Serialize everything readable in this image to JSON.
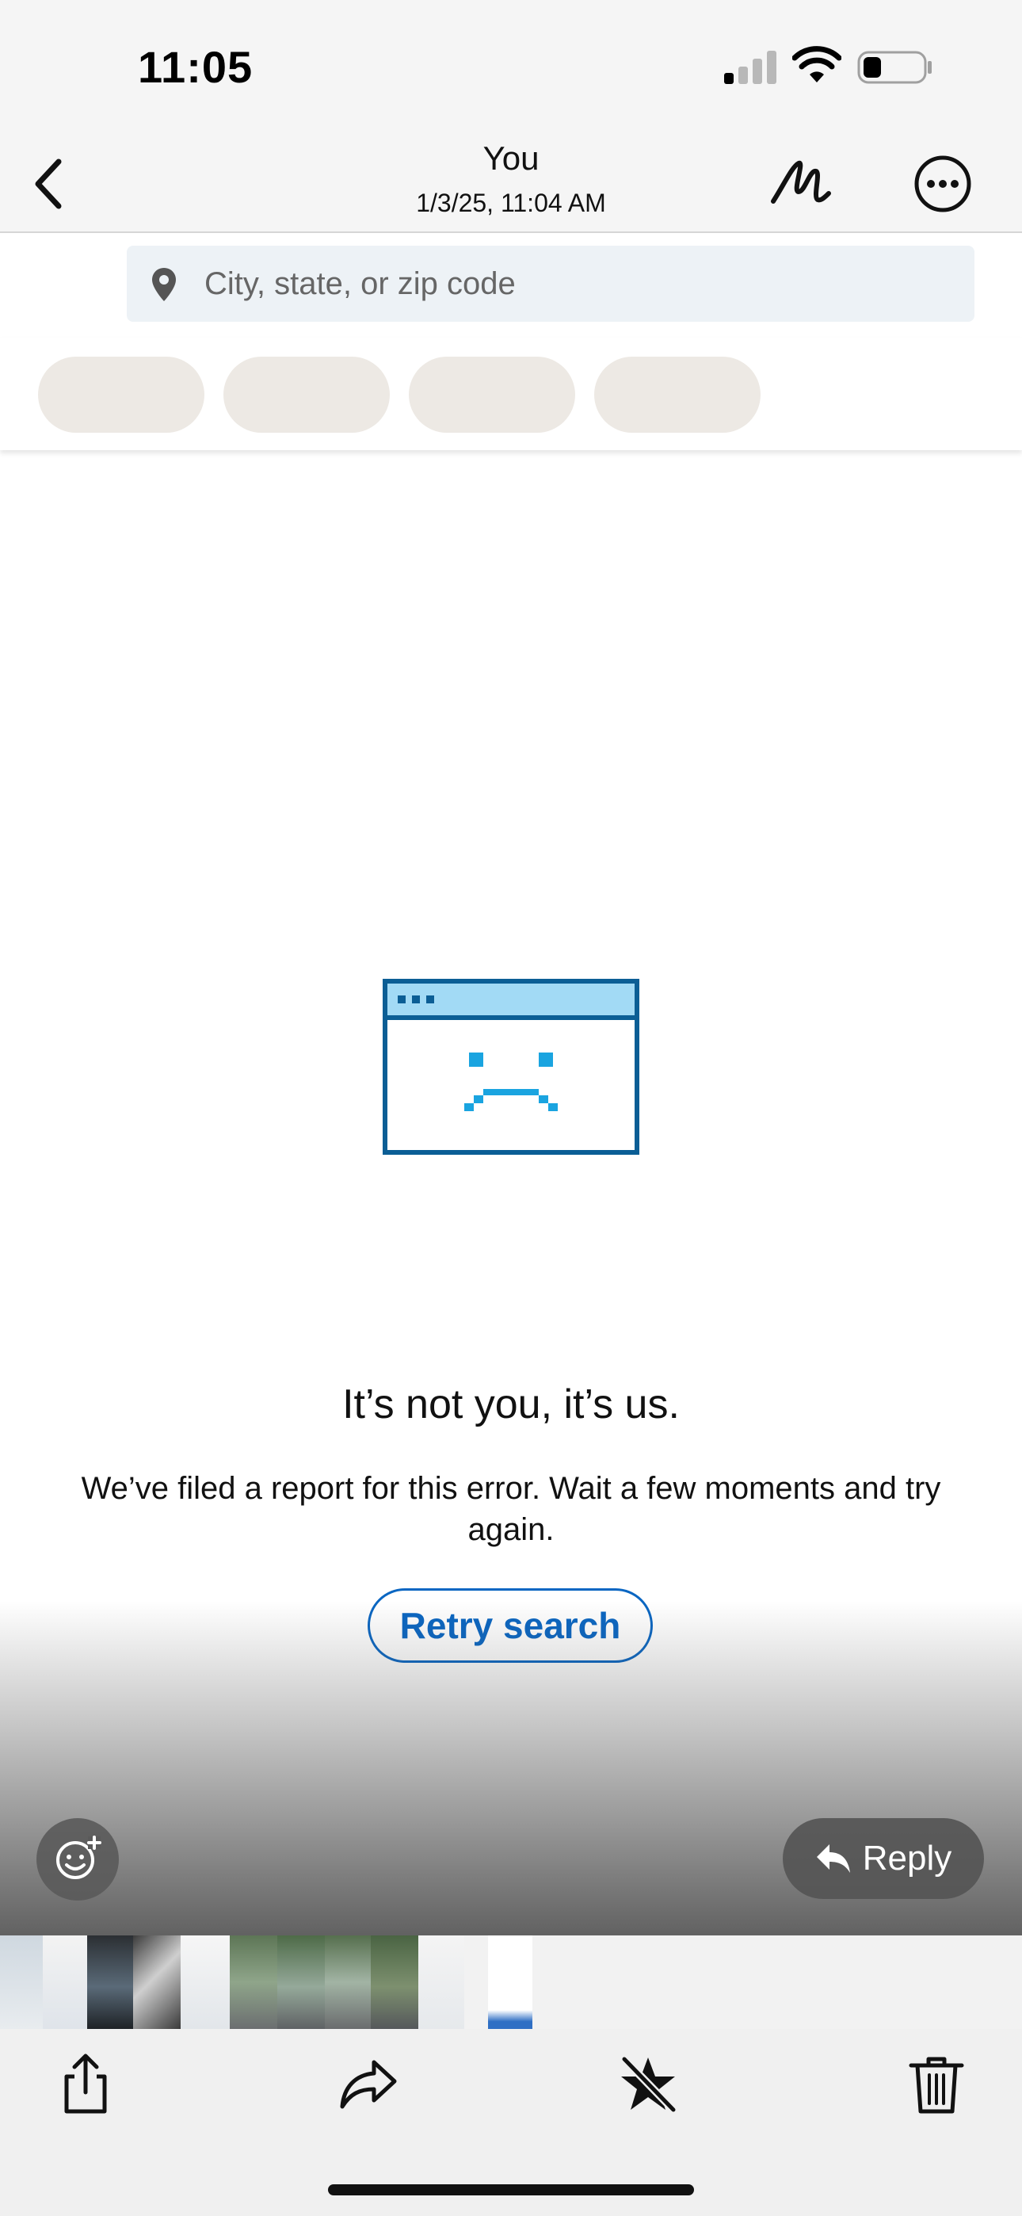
{
  "status_bar": {
    "time": "11:05"
  },
  "header": {
    "title": "You",
    "subtitle": "1/3/25, 11:04 AM"
  },
  "search": {
    "placeholder": "City, state, or zip code"
  },
  "error": {
    "title": "It’s not you, it’s us.",
    "message": "We’ve filed a report for this error. Wait a few moments and try again.",
    "retry_label": "Retry search"
  },
  "viewer_actions": {
    "reply_label": "Reply"
  },
  "icons": {
    "back": "chevron-left-icon",
    "markup": "markup-pen-icon",
    "more": "more-ellipsis-icon",
    "location": "location-pin-icon",
    "error_illustration": "sad-browser-window-icon",
    "emoji": "emoji-add-icon",
    "reply": "reply-arrow-icon",
    "share": "share-icon",
    "forward": "forward-icon",
    "unfavorite": "star-slash-icon",
    "trash": "trash-icon"
  },
  "colors": {
    "accent": "#0a66c2",
    "illustration_dark": "#0b5e95",
    "illustration_light": "#1aa4e0",
    "illustration_bar": "#a2daf5",
    "chip_skeleton": "#ede9e4"
  }
}
